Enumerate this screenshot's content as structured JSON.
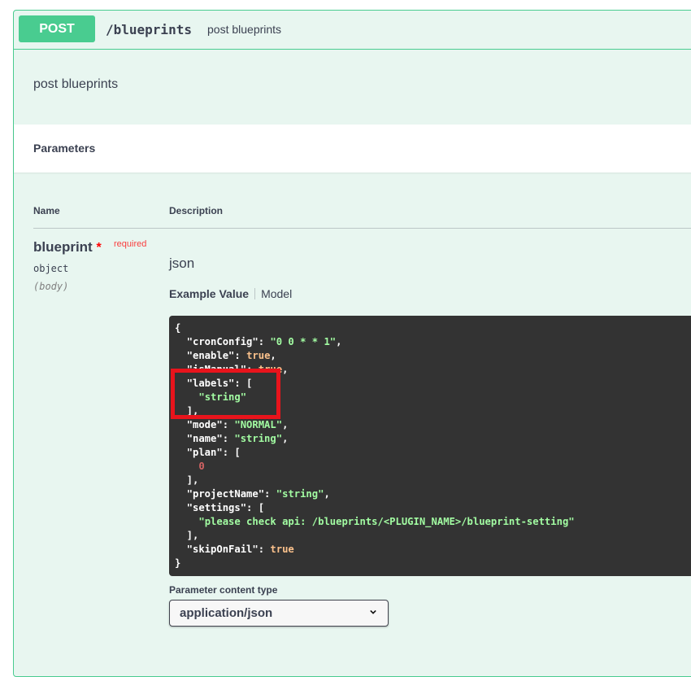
{
  "operation": {
    "method": "POST",
    "path": "/blueprints",
    "summary": "post blueprints",
    "description": "post blueprints"
  },
  "parameters": {
    "section_title": "Parameters",
    "col_name": "Name",
    "col_description": "Description",
    "param": {
      "name": "blueprint",
      "required_star": "*",
      "required_label": "required",
      "type": "object",
      "in": "(body)",
      "description": "json"
    },
    "tabs": {
      "example_value": "Example Value",
      "model": "Model"
    },
    "example_lines": [
      [
        {
          "t": "{",
          "c": "k"
        }
      ],
      [
        {
          "t": "  \"cronConfig\": ",
          "c": "k"
        },
        {
          "t": "\"0 0 * * 1\"",
          "c": "s"
        },
        {
          "t": ",",
          "c": "k"
        }
      ],
      [
        {
          "t": "  \"enable\": ",
          "c": "k"
        },
        {
          "t": "true",
          "c": "b"
        },
        {
          "t": ",",
          "c": "k"
        }
      ],
      [
        {
          "t": "  \"isManual\": ",
          "c": "k"
        },
        {
          "t": "true",
          "c": "b"
        },
        {
          "t": ",",
          "c": "k"
        }
      ],
      [
        {
          "t": "  \"labels\": [",
          "c": "k"
        }
      ],
      [
        {
          "t": "    ",
          "c": "k"
        },
        {
          "t": "\"string\"",
          "c": "s"
        }
      ],
      [
        {
          "t": "  ],",
          "c": "k"
        }
      ],
      [
        {
          "t": "  \"mode\": ",
          "c": "k"
        },
        {
          "t": "\"NORMAL\"",
          "c": "s"
        },
        {
          "t": ",",
          "c": "k"
        }
      ],
      [
        {
          "t": "  \"name\": ",
          "c": "k"
        },
        {
          "t": "\"string\"",
          "c": "s"
        },
        {
          "t": ",",
          "c": "k"
        }
      ],
      [
        {
          "t": "  \"plan\": [",
          "c": "k"
        }
      ],
      [
        {
          "t": "    ",
          "c": "k"
        },
        {
          "t": "0",
          "c": "n"
        }
      ],
      [
        {
          "t": "  ],",
          "c": "k"
        }
      ],
      [
        {
          "t": "  \"projectName\": ",
          "c": "k"
        },
        {
          "t": "\"string\"",
          "c": "s"
        },
        {
          "t": ",",
          "c": "k"
        }
      ],
      [
        {
          "t": "  \"settings\": [",
          "c": "k"
        }
      ],
      [
        {
          "t": "    ",
          "c": "k"
        },
        {
          "t": "\"please check api: /blueprints/<PLUGIN_NAME>/blueprint-setting\"",
          "c": "s"
        }
      ],
      [
        {
          "t": "  ],",
          "c": "k"
        }
      ],
      [
        {
          "t": "  \"skipOnFail\": ",
          "c": "k"
        },
        {
          "t": "true",
          "c": "b"
        }
      ],
      [
        {
          "t": "}",
          "c": "k"
        }
      ]
    ],
    "content_type_label": "Parameter content type",
    "content_type_value": "application/json"
  },
  "colors": {
    "post_green": "#49cc90",
    "block_bg": "#e8f6f0",
    "code_bg": "#333333",
    "highlight_red": "#e8141c"
  },
  "icons": {
    "select_chevron": "chevron-down-icon"
  }
}
